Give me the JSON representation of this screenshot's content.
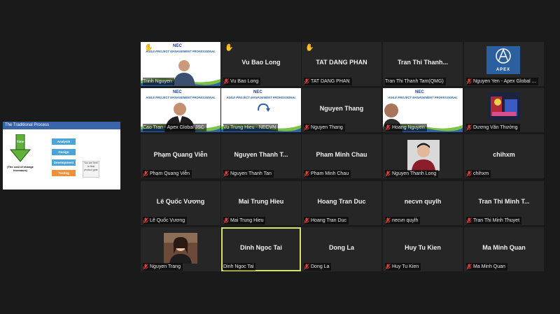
{
  "shared_screen": {
    "title": "The Traditional Process",
    "arrow_label": "Time",
    "arrow_note": "(The cost of change increases)",
    "phases": [
      "Analysis",
      "Design",
      "Development",
      "Testing"
    ],
    "side_note": "You are here to final product gate"
  },
  "participants": [
    {
      "name": "Trinh Nguyen",
      "display": "",
      "hand": true,
      "muted": false
    },
    {
      "name": "Vu Bao Long",
      "display": "Vu Bao Long",
      "hand": true,
      "muted": true
    },
    {
      "name": "TAT DANG PHAN",
      "display": "TAT DANG PHAN",
      "hand": true,
      "muted": true
    },
    {
      "name": "Tran Thi Thanh Tam(QMG)",
      "display": "Tran Thi Thanh...",
      "hand": false,
      "muted": false
    },
    {
      "name": "Nguyen Yen - Apex Global ...",
      "display": "",
      "hand": false,
      "muted": true
    },
    {
      "name": "Cao Tran - Apex Global JSC",
      "display": "",
      "hand": false,
      "muted": false
    },
    {
      "name": "Vu Trung Hieu - NECVN",
      "display": "",
      "hand": false,
      "muted": false
    },
    {
      "name": "Nguyen Thang",
      "display": "Nguyen Thang",
      "hand": false,
      "muted": true
    },
    {
      "name": "Hoang Nguyen",
      "display": "",
      "hand": false,
      "muted": true
    },
    {
      "name": "Dương Văn Thưởng",
      "display": "",
      "hand": false,
      "muted": true
    },
    {
      "name": "Phạm Quang Viễn",
      "display": "Phạm Quang Viễn",
      "hand": false,
      "muted": true
    },
    {
      "name": "Nguyen Thanh Tan",
      "display": "Nguyen Thanh T...",
      "hand": false,
      "muted": true
    },
    {
      "name": "Pham Minh Chau",
      "display": "Pham Minh Chau",
      "hand": false,
      "muted": true
    },
    {
      "name": "Nguyen Thanh Long",
      "display": "",
      "hand": false,
      "muted": true
    },
    {
      "name": "chihxm",
      "display": "chihxm",
      "hand": false,
      "muted": true
    },
    {
      "name": "Lê Quốc Vương",
      "display": "Lê Quốc Vương",
      "hand": false,
      "muted": true
    },
    {
      "name": "Mai Trung Hieu",
      "display": "Mai Trung Hieu",
      "hand": false,
      "muted": true
    },
    {
      "name": "Hoang Tran Duc",
      "display": "Hoang Tran Duc",
      "hand": false,
      "muted": true
    },
    {
      "name": "necvn quylh",
      "display": "necvn quylh",
      "hand": false,
      "muted": true
    },
    {
      "name": "Tran Thi Minh Thuyet",
      "display": "Tran Thi Minh T...",
      "hand": false,
      "muted": true
    },
    {
      "name": "Nguyen Trang",
      "display": "",
      "hand": false,
      "muted": true
    },
    {
      "name": "Dinh Ngoc Tai",
      "display": "Dinh Ngoc Tai",
      "hand": false,
      "muted": false
    },
    {
      "name": "Dong La",
      "display": "Dong La",
      "hand": false,
      "muted": true
    },
    {
      "name": "Huy Tu Kien",
      "display": "Huy Tu Kien",
      "hand": false,
      "muted": true
    },
    {
      "name": "Ma Minh Quan",
      "display": "Ma Minh Quan",
      "hand": false,
      "muted": true
    }
  ],
  "slide_brand": {
    "logo": "NEC",
    "subtitle": "AGILE PROJECT MANAGEMENT PROFESSIONAL"
  },
  "apex_logo_text": "APEX",
  "colors": {
    "background": "#1a1a1a",
    "tile": "#262626",
    "active_speaker": "#d8e26d",
    "muted_icon": "#e0443e",
    "hand_icon": "#f6c23c"
  }
}
